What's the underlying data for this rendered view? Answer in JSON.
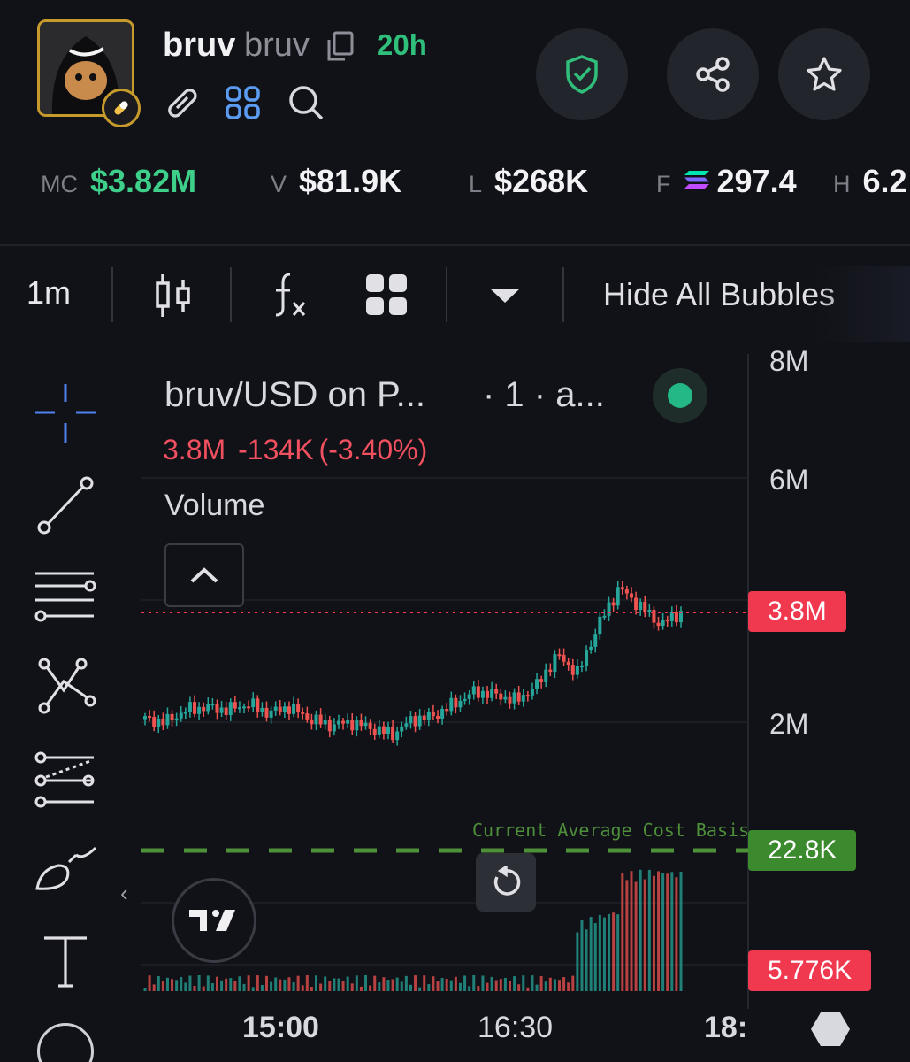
{
  "header": {
    "name": "bruv",
    "ticker": "bruv",
    "age": "20h"
  },
  "stats": {
    "mc": {
      "label": "MC",
      "value": "$3.82M"
    },
    "v": {
      "label": "V",
      "value": "$81.9K"
    },
    "l": {
      "label": "L",
      "value": "$268K"
    },
    "f": {
      "label": "F",
      "value": "297.4"
    },
    "h": {
      "label": "H",
      "value": "6.2"
    }
  },
  "toolbar": {
    "interval": "1m",
    "hide_bubbles": "Hide All Bubbles"
  },
  "chart_legend": {
    "title": "bruv/USD on P...",
    "interval": "· 1 · a...",
    "last": "3.8M",
    "change": "-134K",
    "change_pct": "(-3.40%)",
    "volume_label": "Volume"
  },
  "chart_overlay": {
    "cost_basis_label": "Current Average Cost Basis",
    "cost_basis_value": "22.8K",
    "price_tag": "3.8M",
    "volume_tag": "5.776K"
  },
  "chart_data": {
    "type": "candlestick",
    "y_axis_labels": [
      "8M",
      "6M",
      "2M"
    ],
    "x_axis_labels": [
      "15:00",
      "16:30",
      "18:"
    ],
    "series_close_approx_M": [
      2.05,
      2.0,
      2.2,
      2.25,
      2.2,
      2.3,
      2.15,
      2.25,
      2.05,
      1.95,
      2.0,
      1.9,
      1.8,
      2.05,
      2.1,
      2.3,
      2.5,
      2.45,
      2.35,
      2.6,
      3.1,
      2.8,
      3.6,
      4.2,
      3.9,
      3.6,
      3.8
    ],
    "last_price": "3.8M",
    "colors": {
      "up": "#26a69a",
      "down": "#ef5350",
      "cost_basis": "#4e8f3a"
    }
  }
}
